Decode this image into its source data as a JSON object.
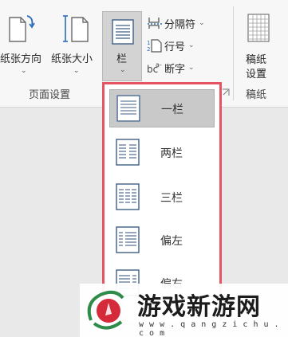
{
  "ribbon": {
    "page_setup": {
      "orientation_label": "纸张方向",
      "size_label": "纸张大小",
      "columns_label": "栏",
      "breaks_label": "分隔符",
      "line_numbers_label": "行号",
      "hyphenation_label": "断字",
      "group_label": "页面设置",
      "caret": "⌄"
    },
    "manuscript": {
      "setup_label_line1": "稿纸",
      "setup_label_line2": "设置",
      "group_label": "稿纸"
    }
  },
  "columns_menu": {
    "items": [
      {
        "label": "一栏",
        "selected": true,
        "icon": "one-column-icon"
      },
      {
        "label": "两栏",
        "selected": false,
        "icon": "two-columns-icon"
      },
      {
        "label": "三栏",
        "selected": false,
        "icon": "three-columns-icon"
      },
      {
        "label": "偏左",
        "selected": false,
        "icon": "left-column-icon"
      },
      {
        "label": "偏右",
        "selected": false,
        "icon": "right-column-icon"
      }
    ],
    "highlight_color": "#e45561"
  },
  "watermark": {
    "title": "游戏新游网",
    "url": "w w w . q a n g z i c h u . c o m"
  }
}
